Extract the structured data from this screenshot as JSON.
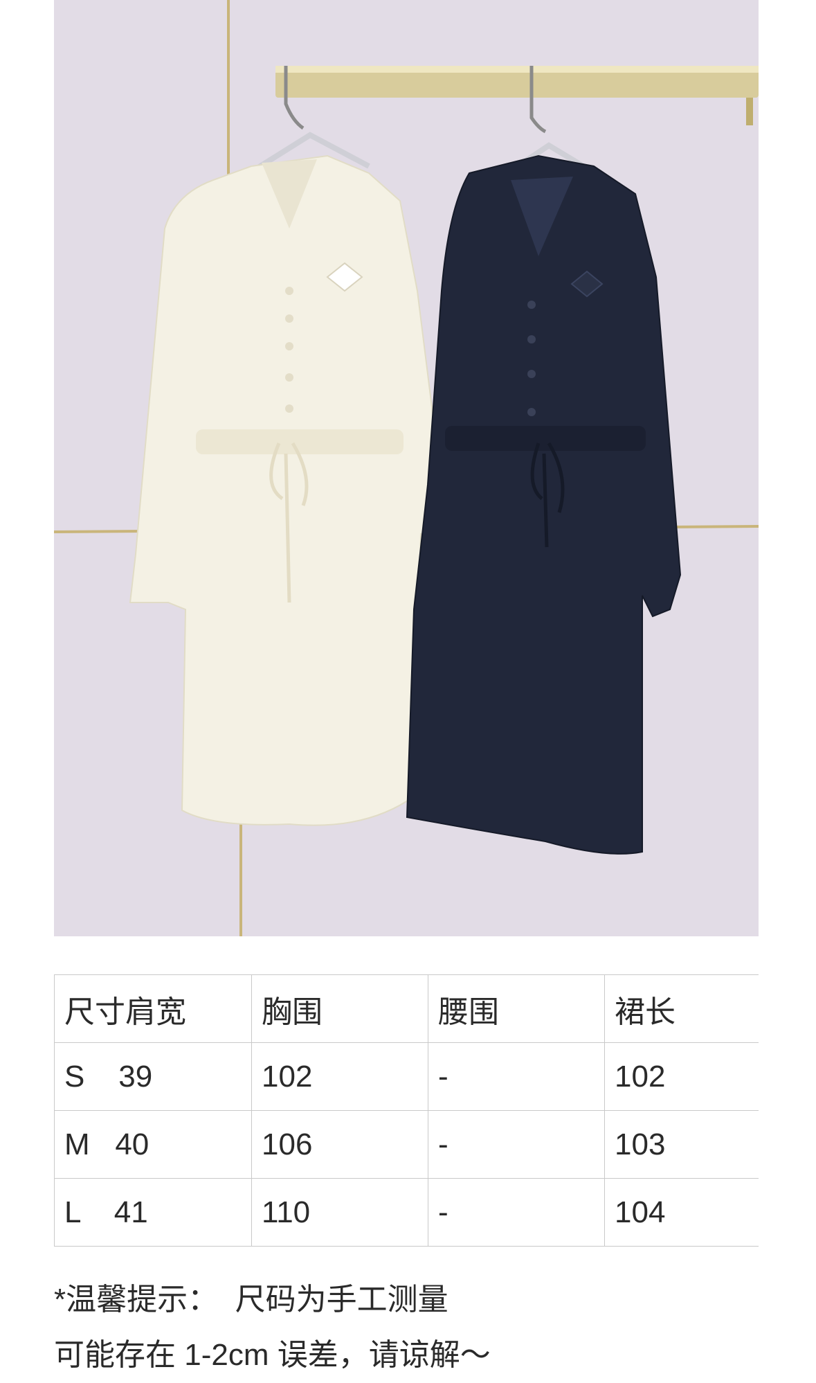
{
  "photo": {
    "alt": "two drawstring shirt dresses on hangers"
  },
  "size_table": {
    "headers": [
      "尺寸肩宽",
      "胸围",
      "腰围",
      "裙长"
    ],
    "rows": [
      [
        "S    39",
        "102",
        "-",
        "102"
      ],
      [
        "M   40",
        "106",
        "-",
        "103"
      ],
      [
        "L    41",
        "110",
        "-",
        "104"
      ]
    ]
  },
  "note": {
    "line1": "*温馨提示：  尺码为手工测量",
    "line2": "可能存在 1-2cm 误差，请谅解～"
  }
}
